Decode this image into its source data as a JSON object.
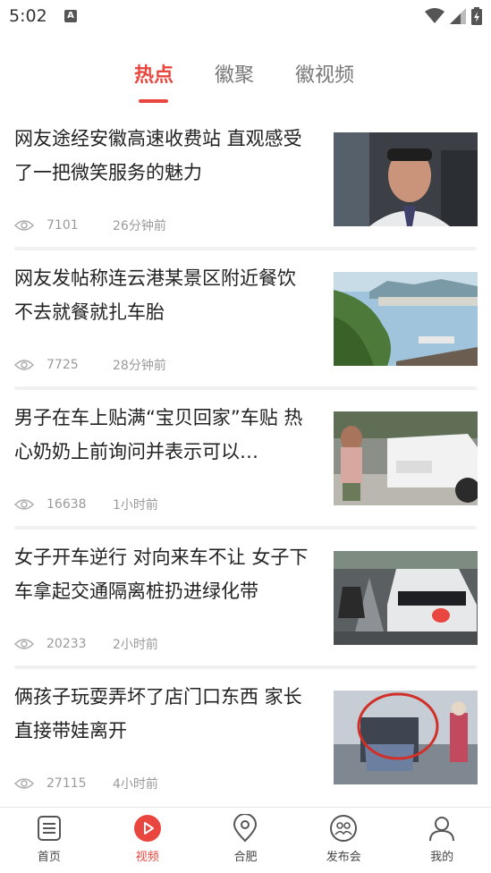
{
  "status": {
    "time": "5:02",
    "notif_letter": "A"
  },
  "tabs": [
    {
      "label": "热点",
      "active": true
    },
    {
      "label": "徽聚",
      "active": false
    },
    {
      "label": "徽视频",
      "active": false
    }
  ],
  "feed": [
    {
      "title": "网友途经安徽高速收费站 直观感受了一把微笑服务的魅力",
      "views": "7101",
      "time": "26分钟前"
    },
    {
      "title": "网友发帖称连云港某景区附近餐饮 不去就餐就扎车胎",
      "views": "7725",
      "time": "28分钟前"
    },
    {
      "title": "男子在车上贴满“宝贝回家”车贴 热心奶奶上前询问并表示可以…",
      "views": "16638",
      "time": "1小时前"
    },
    {
      "title": "女子开车逆行 对向来车不让 女子下车拿起交通隔离桩扔进绿化带",
      "views": "20233",
      "time": "2小时前"
    },
    {
      "title": "俩孩子玩耍弄坏了店门口东西 家长直接带娃离开",
      "views": "27115",
      "time": "4小时前"
    }
  ],
  "nav": [
    {
      "label": "首页",
      "icon": "home-icon"
    },
    {
      "label": "视频",
      "icon": "video-icon",
      "active": true
    },
    {
      "label": "合肥",
      "icon": "location-icon"
    },
    {
      "label": "发布会",
      "icon": "press-icon"
    },
    {
      "label": "我的",
      "icon": "profile-icon"
    }
  ],
  "colors": {
    "accent": "#e8463e",
    "meta_text": "#9a9a9a"
  }
}
